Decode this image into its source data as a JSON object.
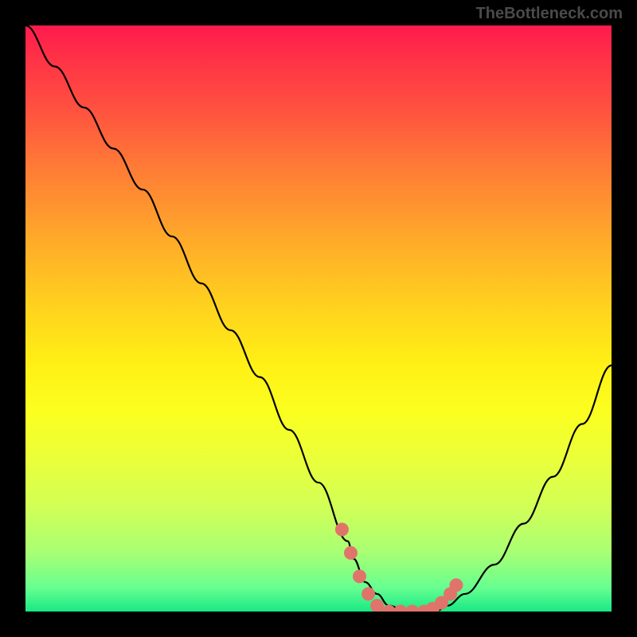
{
  "watermark": "TheBottleneck.com",
  "chart_data": {
    "type": "line",
    "title": "",
    "xlabel": "",
    "ylabel": "",
    "xlim": [
      0,
      100
    ],
    "ylim": [
      0,
      100
    ],
    "series": [
      {
        "name": "bottleneck-curve",
        "x": [
          0,
          5,
          10,
          15,
          20,
          25,
          30,
          35,
          40,
          45,
          50,
          55,
          56,
          58,
          60,
          62,
          65,
          68,
          70,
          72,
          75,
          80,
          85,
          90,
          95,
          100
        ],
        "y": [
          100,
          93,
          86,
          79,
          72,
          64,
          56,
          48,
          40,
          31,
          22,
          12,
          9,
          5,
          3,
          1,
          0,
          0,
          0,
          1,
          3,
          8,
          15,
          23,
          32,
          42
        ]
      }
    ],
    "highlight": {
      "name": "optimal-zone",
      "color": "#e0746a",
      "points": [
        {
          "x": 54,
          "y": 14
        },
        {
          "x": 55.5,
          "y": 10
        },
        {
          "x": 57,
          "y": 6
        },
        {
          "x": 58.5,
          "y": 3
        },
        {
          "x": 60,
          "y": 1
        },
        {
          "x": 62,
          "y": 0
        },
        {
          "x": 64,
          "y": 0
        },
        {
          "x": 66,
          "y": 0
        },
        {
          "x": 68,
          "y": 0
        },
        {
          "x": 69.5,
          "y": 0.5
        },
        {
          "x": 71,
          "y": 1.5
        },
        {
          "x": 72.5,
          "y": 3
        },
        {
          "x": 73.5,
          "y": 4.5
        }
      ]
    },
    "gradient_stops": [
      {
        "pos": 0,
        "color": "#ff1a4d"
      },
      {
        "pos": 50,
        "color": "#ffd21e"
      },
      {
        "pos": 100,
        "color": "#18e884"
      }
    ]
  }
}
